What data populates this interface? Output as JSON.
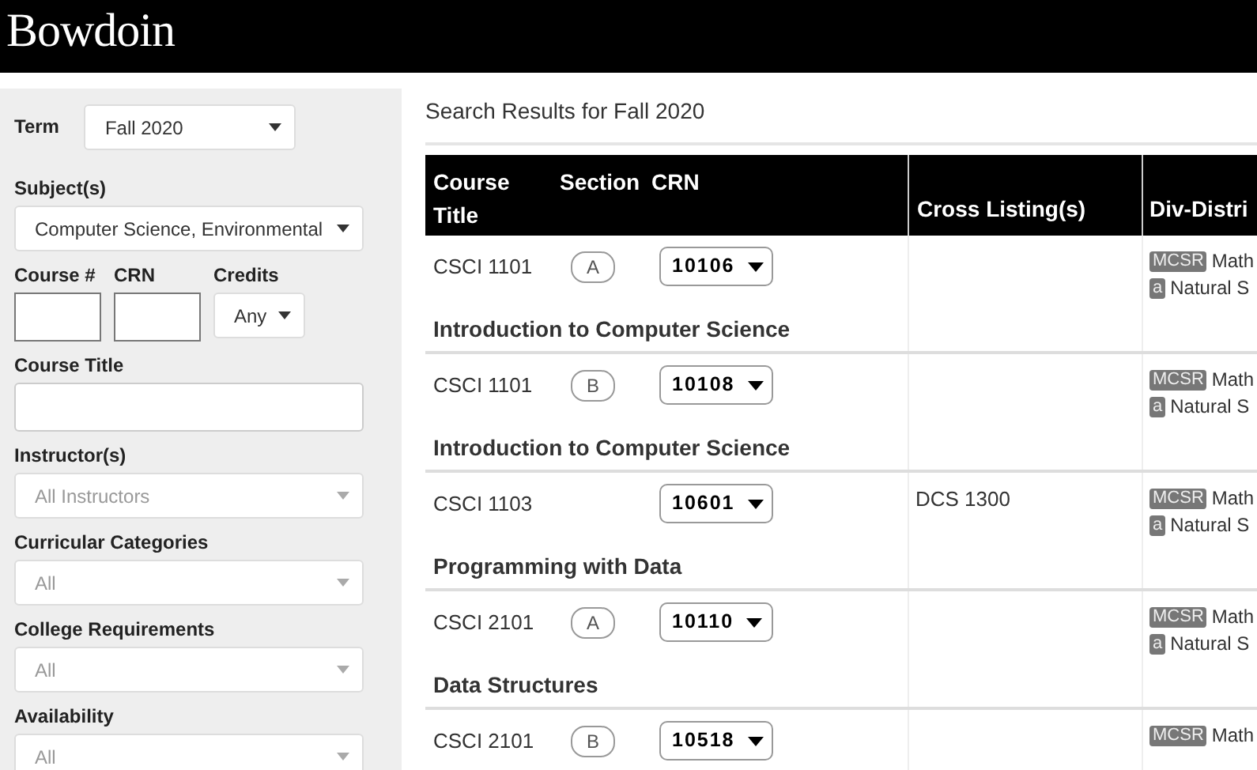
{
  "header": {
    "logo": "Bowdoin"
  },
  "filters": [
    {
      "kind": "inline-select",
      "label": "Term",
      "value": "Fall 2020"
    },
    {
      "kind": "select",
      "label": "Subject(s)",
      "value": "Computer Science, Environmental"
    },
    {
      "kind": "group",
      "fields": [
        {
          "kind": "text",
          "label": "Course #"
        },
        {
          "kind": "text",
          "label": "CRN"
        },
        {
          "kind": "select",
          "label": "Credits",
          "value": "Any"
        }
      ]
    },
    {
      "kind": "text",
      "label": "Course Title"
    },
    {
      "kind": "select",
      "label": "Instructor(s)",
      "placeholder": "All Instructors"
    },
    {
      "kind": "select",
      "label": "Curricular Categories",
      "placeholder": "All"
    },
    {
      "kind": "select",
      "label": "College Requirements",
      "placeholder": "All"
    },
    {
      "kind": "select",
      "label": "Availability",
      "placeholder": "All"
    }
  ],
  "results": {
    "title": "Search Results for Fall 2020",
    "columns": [
      "Course Title",
      "Section",
      "CRN",
      "Cross Listing(s)",
      "Div-Distri"
    ],
    "rows": [
      {
        "code": "CSCI 1101",
        "section": "A",
        "crn": "10106",
        "title": "Introduction to Computer Science",
        "distributions": [
          {
            "tag": "MCSR",
            "text": "Math"
          },
          {
            "tag": "a",
            "text": "Natural S"
          }
        ]
      },
      {
        "code": "CSCI 1101",
        "section": "B",
        "crn": "10108",
        "title": "Introduction to Computer Science",
        "distributions": [
          {
            "tag": "MCSR",
            "text": "Math"
          },
          {
            "tag": "a",
            "text": "Natural S"
          }
        ]
      },
      {
        "code": "CSCI 1103",
        "crn": "10601",
        "title": "Programming with Data",
        "cross_listing": "DCS 1300",
        "distributions": [
          {
            "tag": "MCSR",
            "text": "Math"
          },
          {
            "tag": "a",
            "text": "Natural S"
          }
        ]
      },
      {
        "code": "CSCI 2101",
        "section": "A",
        "crn": "10110",
        "title": "Data Structures",
        "distributions": [
          {
            "tag": "MCSR",
            "text": "Math"
          },
          {
            "tag": "a",
            "text": "Natural S"
          }
        ]
      },
      {
        "code": "CSCI 2101",
        "section": "B",
        "crn": "10518",
        "distributions": [
          {
            "tag": "MCSR",
            "text": "Math"
          }
        ]
      }
    ]
  }
}
